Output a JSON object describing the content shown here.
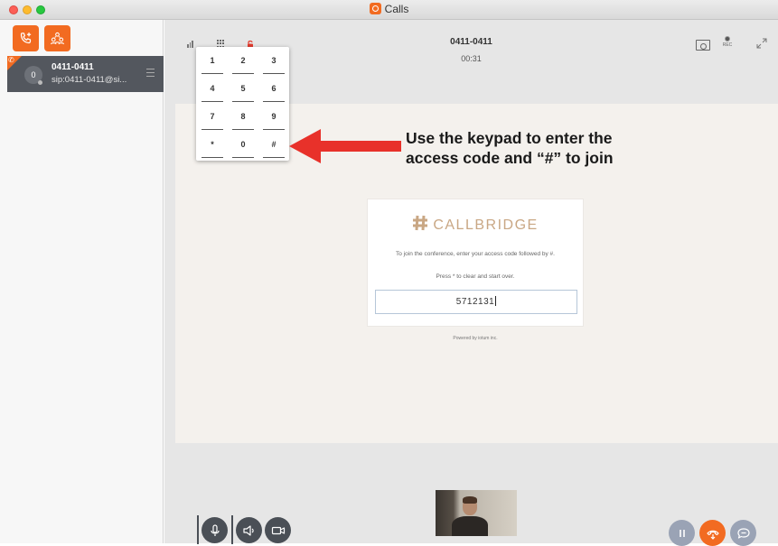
{
  "window": {
    "title": "Calls",
    "title_icon": "calls-app-logo-icon"
  },
  "sidebar": {
    "buttons": [
      {
        "name": "new-call-button",
        "icon": "phone-plus-icon",
        "color": "#f26b21"
      },
      {
        "name": "conference-button",
        "icon": "people-icon",
        "color": "#f26b21"
      }
    ],
    "active_call": {
      "avatar_text": "0",
      "name": "0411-0411",
      "sip": "sip:0411-0411@si...",
      "icon": "phone-icon"
    }
  },
  "call_header": {
    "name": "0411-0411",
    "timer": "00:31",
    "icons": [
      "signal-icon",
      "keypad-icon",
      "lock-icon",
      "screen-share-icon",
      "record-icon",
      "expand-icon"
    ],
    "rec_label": "REC"
  },
  "keypad": {
    "keys": [
      "1",
      "2",
      "3",
      "4",
      "5",
      "6",
      "7",
      "8",
      "9",
      "*",
      "0",
      "#"
    ]
  },
  "annotation": {
    "line1": "Use the keypad to enter the",
    "line2": "access code and “#” to join",
    "arrow_color": "#e8312a"
  },
  "callbridge": {
    "brand": "CALLBRIDGE",
    "brand_color": "#c9a784",
    "instruction1": "To join the conference, enter your access code followed by #.",
    "instruction2": "Press * to clear and start over.",
    "input_value": "5712131",
    "powered_by": "Powered by iotum inc."
  },
  "controls": {
    "left": [
      "microphone-icon",
      "speaker-icon",
      "camera-icon"
    ],
    "right": [
      {
        "icon": "pause-icon",
        "color": "#9aa3b5"
      },
      {
        "icon": "hangup-icon",
        "color": "#f26b21"
      },
      {
        "icon": "chat-icon",
        "color": "#9aa3b5"
      }
    ]
  }
}
